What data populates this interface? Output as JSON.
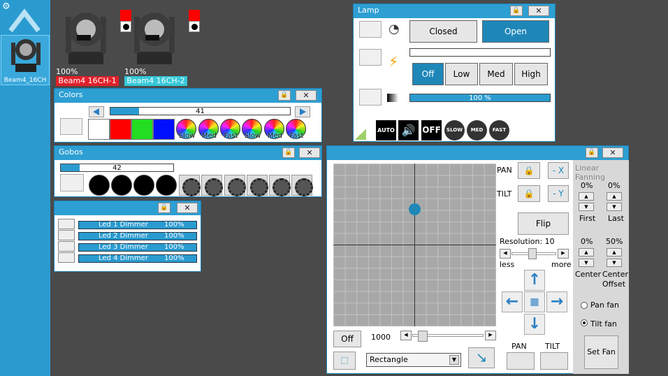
{
  "sidebar": {
    "fixture_name": "Beam4_16CH"
  },
  "fixtures": [
    {
      "label": "Beam4 16CH-1",
      "percent": "100%",
      "color": "#e0202a"
    },
    {
      "label": "Beam4 16CH-2",
      "percent": "100%",
      "color": "#36c8d8"
    }
  ],
  "colors": {
    "title": "Colors",
    "value": "41",
    "fill_fraction": 0.16,
    "swatches": [
      "#ffffff",
      "#ff0000",
      "#22dd22",
      "#0010ff"
    ],
    "wheels": [
      "Slow",
      "Med",
      "Fast",
      "Slow",
      "Med",
      "Fast"
    ]
  },
  "gobos": {
    "title": "Gobos",
    "value": "42",
    "fill_fraction": 0.17
  },
  "leds": {
    "title": "",
    "rows": [
      {
        "label": "Led 1 Dimmer",
        "percent": "100%"
      },
      {
        "label": "Led 2 Dimmer",
        "percent": "100%"
      },
      {
        "label": "Led 3 Dimmer",
        "percent": "100%"
      },
      {
        "label": "Led 4 Dimmer",
        "percent": "100%"
      }
    ]
  },
  "lamp": {
    "title": "Lamp",
    "closed": "Closed",
    "open": "Open",
    "off": "Off",
    "low": "Low",
    "med": "Med",
    "high": "High",
    "intensity": "100 %",
    "intensity_fraction": 1.0,
    "effects": [
      "AUTO",
      "SOUND",
      "OFF",
      "SLOW",
      "MED",
      "FAST"
    ]
  },
  "pantilt": {
    "pan": "PAN",
    "tilt": "TILT",
    "minus_x": "- X",
    "minus_y": "- Y",
    "flip": "Flip",
    "resolution": "Resolution: 10",
    "less": "less",
    "more": "more",
    "off": "Off",
    "speed": "1000",
    "shape": "Rectangle",
    "pan_bottom": "PAN",
    "tilt_bottom": "TILT"
  },
  "fanning": {
    "title": "Linear Fanning",
    "first_pct": "0%",
    "last_pct": "0%",
    "first": "First",
    "last": "Last",
    "center_pct": "0%",
    "offset_pct": "50%",
    "center": "Center",
    "center_offset": "Center\nOffset",
    "pan_fan": "Pan fan",
    "tilt_fan": "Tilt fan",
    "set_fan": "Set Fan"
  }
}
